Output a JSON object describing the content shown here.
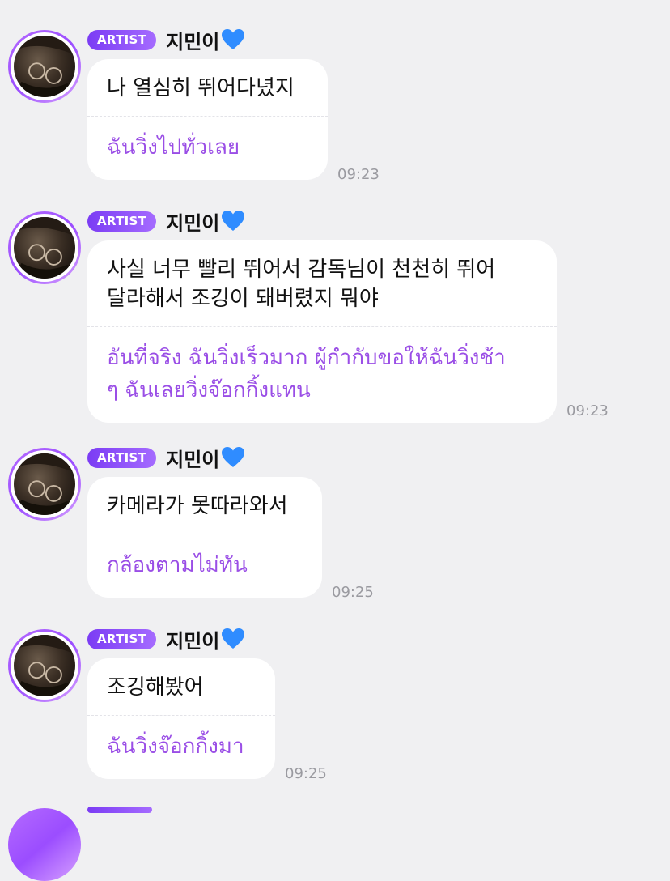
{
  "badge_label": "ARTIST",
  "sender_name": "지민이",
  "heart_color": "#2f8cff",
  "accent_color": "#9a4ee6",
  "messages": [
    {
      "korean": "나 열심히 뛰어다녔지",
      "thai": "ฉันวิ่งไปทั่วเลย",
      "time": "09:23"
    },
    {
      "korean": "사실 너무 빨리 뛰어서 감독님이 천천히 뛰어\n달라해서 조깅이 돼버렸지 뭐야",
      "thai": "อันที่จริง ฉันวิ่งเร็วมาก ผู้กำกับขอให้ฉันวิ่งช้า\nๆ ฉันเลยวิ่งจ๊อกกิ้งแทน",
      "time": "09:23"
    },
    {
      "korean": "카메라가 못따라와서",
      "thai": "กล้องตามไม่ทัน",
      "time": "09:25"
    },
    {
      "korean": "조깅해봤어",
      "thai": "ฉันวิ่งจ๊อกกิ้งมา",
      "time": "09:25"
    }
  ]
}
